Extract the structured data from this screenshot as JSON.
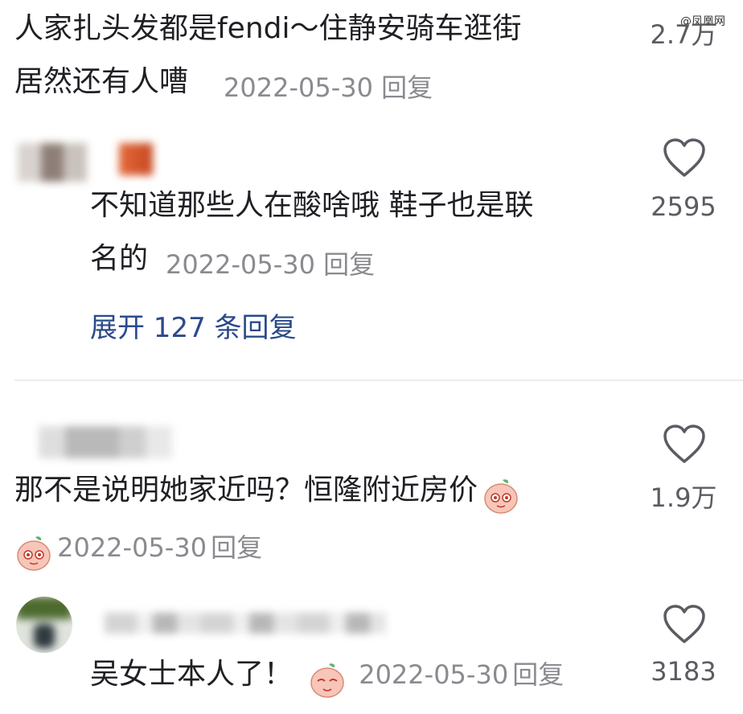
{
  "watermark": "@凤凰网",
  "comment_top": {
    "line1": "人家扎头发都是fendi～住静安骑车逛街",
    "line2": "居然还有人嘈",
    "date": "2022-05-30",
    "reply": "回复",
    "likes": "2.7万"
  },
  "comment_2": {
    "line1": "不知道那些人在酸啥哦 鞋子也是联",
    "line2": "名的",
    "date": "2022-05-30",
    "reply": "回复",
    "likes": "2595",
    "expand": "展开 127 条回复"
  },
  "comment_3": {
    "text": "那不是说明她家近吗？恒隆附近房价",
    "date": "2022-05-30",
    "reply": "回复",
    "likes": "1.9万"
  },
  "comment_4": {
    "text": "吴女士本人了！",
    "date": "2022-05-30",
    "reply": "回复",
    "likes": "3183"
  },
  "colors": {
    "link": "#2b4a8c",
    "meta": "#8a8a90",
    "text": "#1f1f24",
    "emoji_face": "#f7c6b8"
  },
  "icons": [
    "heart-outline-icon",
    "peach-emoji-icon"
  ]
}
